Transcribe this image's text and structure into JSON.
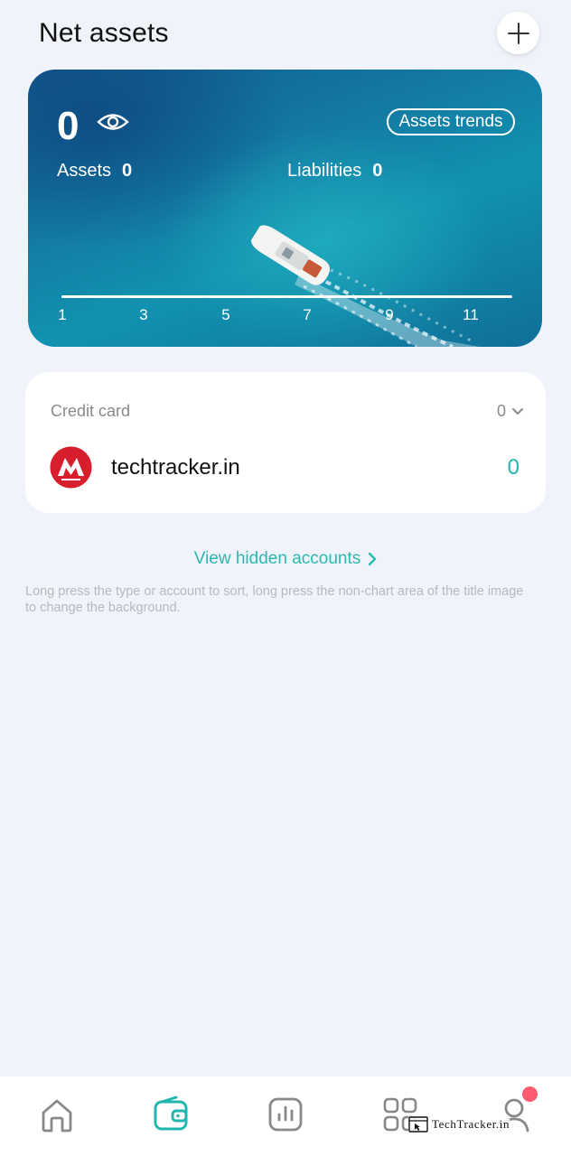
{
  "header": {
    "title": "Net assets"
  },
  "hero": {
    "net_value": "0",
    "trends_label": "Assets trends",
    "assets_label": "Assets",
    "assets_value": "0",
    "liabilities_label": "Liabilities",
    "liabilities_value": "0",
    "axis_ticks": [
      "1",
      "3",
      "5",
      "7",
      "9",
      "11"
    ]
  },
  "credit_card": {
    "title": "Credit card",
    "total": "0",
    "accounts": [
      {
        "name": "techtracker.in",
        "value": "0"
      }
    ]
  },
  "hidden_accounts_label": "View hidden accounts",
  "hint": "Long press the type or account to sort, long press the non-chart area of the title image to change the background.",
  "bottom_nav": {
    "items": [
      "home-icon",
      "wallet-icon",
      "stats-icon",
      "apps-icon",
      "profile-icon"
    ],
    "active": "wallet-icon"
  },
  "watermark": "TechTracker.in",
  "colors": {
    "accent": "#21b7ae",
    "background": "#f0f3fa",
    "badge": "#ff5b6e",
    "bank_logo": "#d81e2c"
  }
}
